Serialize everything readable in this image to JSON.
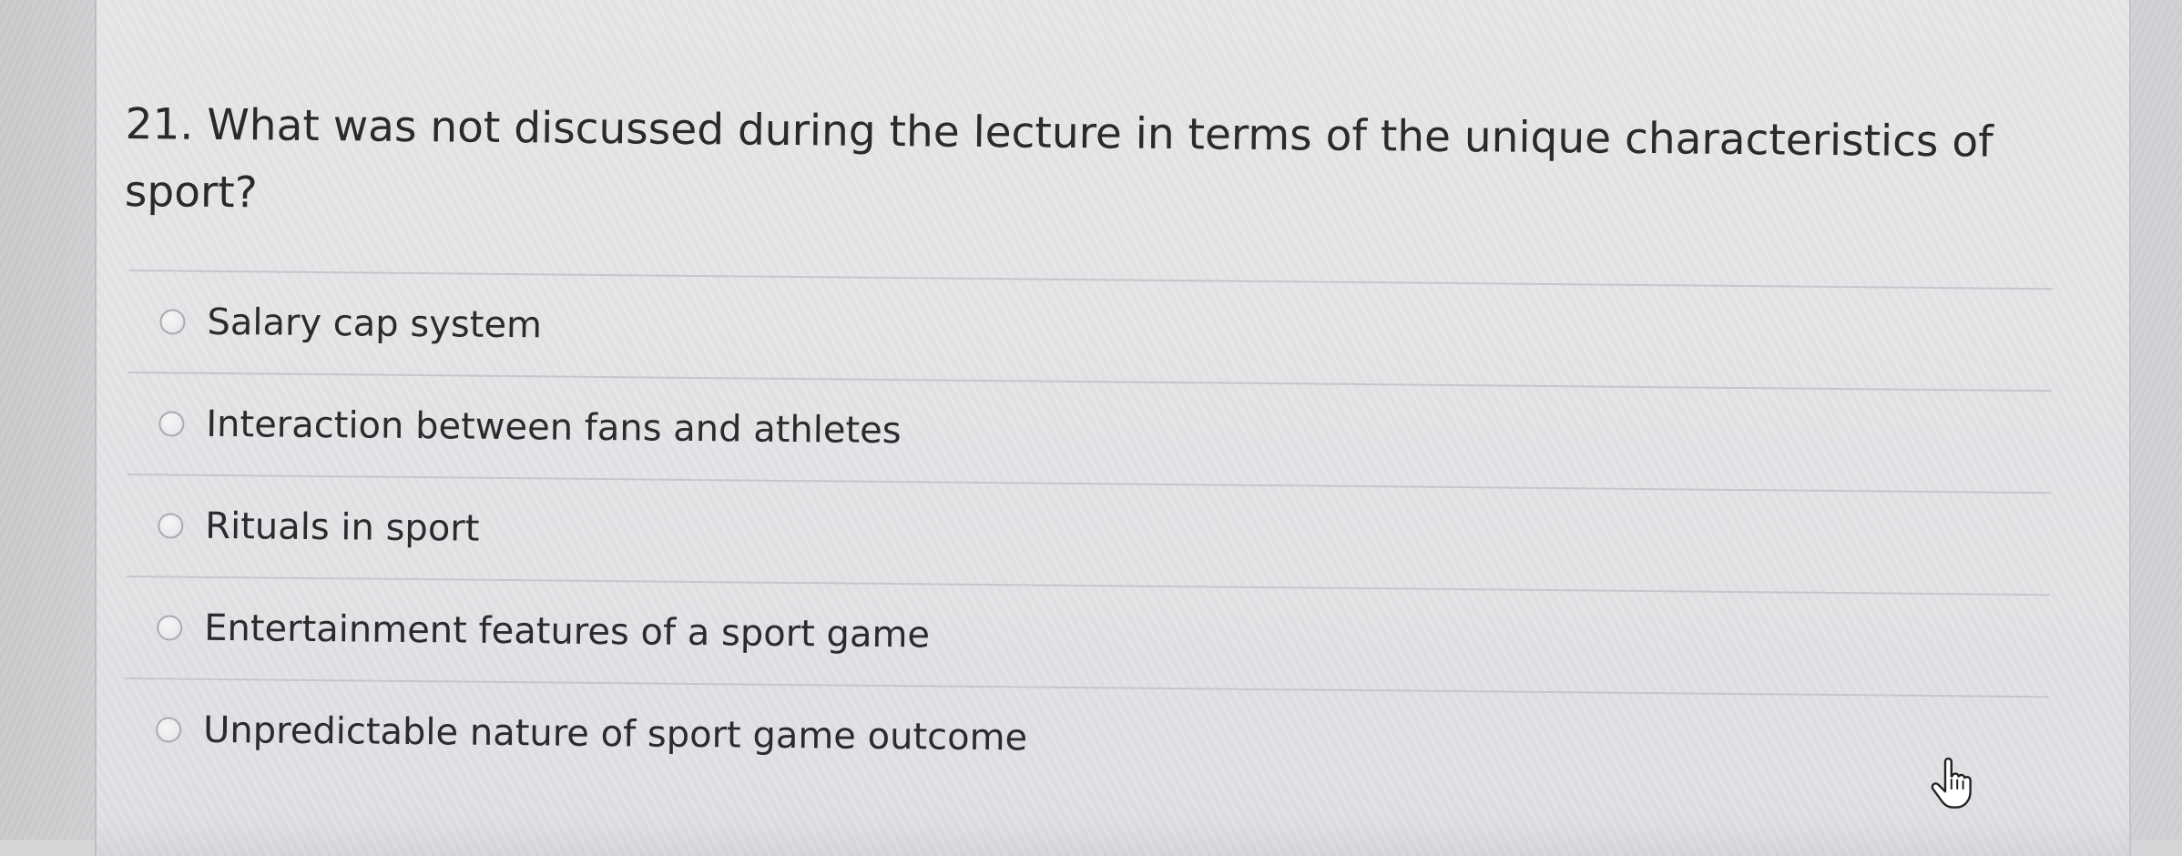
{
  "question": {
    "text": "21. What was not discussed during the lecture in terms of the unique characteristics of sport?"
  },
  "answers": [
    {
      "label": "Salary cap system",
      "selected": false
    },
    {
      "label": "Interaction between fans and athletes",
      "selected": false
    },
    {
      "label": "Rituals in sport",
      "selected": false
    },
    {
      "label": "Entertainment features of a sport game",
      "selected": false
    },
    {
      "label": "Unpredictable nature of sport game outcome",
      "selected": false
    }
  ],
  "cursor": {
    "icon": "hand-pointer-icon"
  },
  "colors": {
    "text": "#2b2b2e",
    "card": "#e4e4e7",
    "divider": "#c6c7ca",
    "radio_border": "#a9abaf"
  }
}
